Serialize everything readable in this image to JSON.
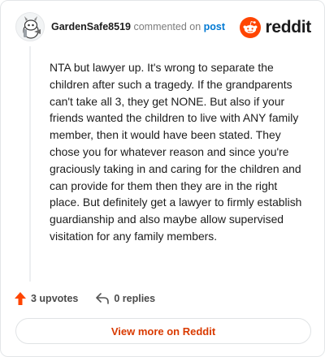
{
  "header": {
    "username": "GardenSafe8519",
    "action_text": "commented on",
    "post_link": "post",
    "brand": "reddit"
  },
  "comment": {
    "body": "NTA but lawyer up. It's wrong to separate the children after such a tragedy. If the grandparents can't take all 3, they get NONE. But also if your friends wanted the children to live with ANY family member, then it would have been stated. They chose you for whatever reason and since you're graciously taking in and caring for the children and can provide for them then they are in the right place. But definitely get a lawyer to firmly establish guardianship and also maybe allow supervised visitation for any family members."
  },
  "actions": {
    "upvotes": "3 upvotes",
    "replies": "0 replies"
  },
  "footer": {
    "view_more": "View more on Reddit"
  },
  "colors": {
    "brand_orange": "#ff4500",
    "link_blue": "#0079d3",
    "cta_orange": "#d93a00"
  },
  "icons": {
    "avatar": "snoo-avatar-icon",
    "brand": "reddit-logo-icon",
    "upvote": "upvote-arrow-icon",
    "reply": "reply-arrow-icon"
  }
}
